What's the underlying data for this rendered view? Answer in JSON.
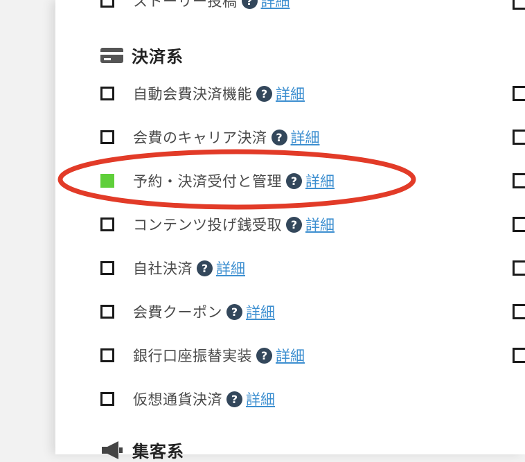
{
  "prev_item": {
    "label": "ストーリー投稿",
    "detail": "詳細"
  },
  "payment_section": {
    "title": "決済系",
    "icon": "credit-card-icon",
    "items": [
      {
        "label": "自動会費決済機能",
        "detail": "詳細",
        "checked": false
      },
      {
        "label": "会費のキャリア決済",
        "detail": "詳細",
        "checked": false
      },
      {
        "label": "予約・決済受付と管理",
        "detail": "詳細",
        "checked": true
      },
      {
        "label": "コンテンツ投げ銭受取",
        "detail": "詳細",
        "checked": false
      },
      {
        "label": "自社決済",
        "detail": "詳細",
        "checked": false
      },
      {
        "label": "会費クーポン",
        "detail": "詳細",
        "checked": false
      },
      {
        "label": "銀行口座振替実装",
        "detail": "詳細",
        "checked": false
      },
      {
        "label": "仮想通貨決済",
        "detail": "詳細",
        "checked": false
      }
    ]
  },
  "next_section": {
    "title": "集客系",
    "icon": "megaphone-icon"
  },
  "help_glyph": "?",
  "colors": {
    "checked": "#5fcf3a",
    "link": "#3d8fd0",
    "help_bg": "#33475b",
    "highlight_ring": "#e23b28"
  }
}
